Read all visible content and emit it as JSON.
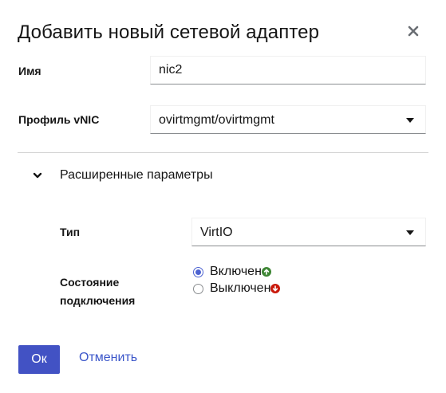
{
  "dialog": {
    "title": "Добавить новый сетевой адаптер"
  },
  "form": {
    "name": {
      "label": "Имя",
      "value": "nic2"
    },
    "vnic_profile": {
      "label": "Профиль vNIC",
      "selected": "ovirtmgmt/ovirtmgmt"
    }
  },
  "advanced": {
    "toggle_label": "Расширенные параметры",
    "expanded": true,
    "type": {
      "label": "Тип",
      "selected": "VirtIO"
    },
    "link_state": {
      "label_line1": "Состояние",
      "label_line2": "подключения",
      "options": [
        {
          "label": "Включен",
          "checked": true,
          "status_icon": "arrow-up-circle-icon",
          "status_color": "#3e8635"
        },
        {
          "label": "Выключен",
          "checked": false,
          "status_icon": "arrow-down-circle-icon",
          "status_color": "#c9190b"
        }
      ]
    }
  },
  "footer": {
    "ok_label": "Ок",
    "cancel_label": "Отменить"
  },
  "colors": {
    "primary": "#4252c4",
    "link": "#3a55c9",
    "radio_accent": "#4d63d1"
  }
}
